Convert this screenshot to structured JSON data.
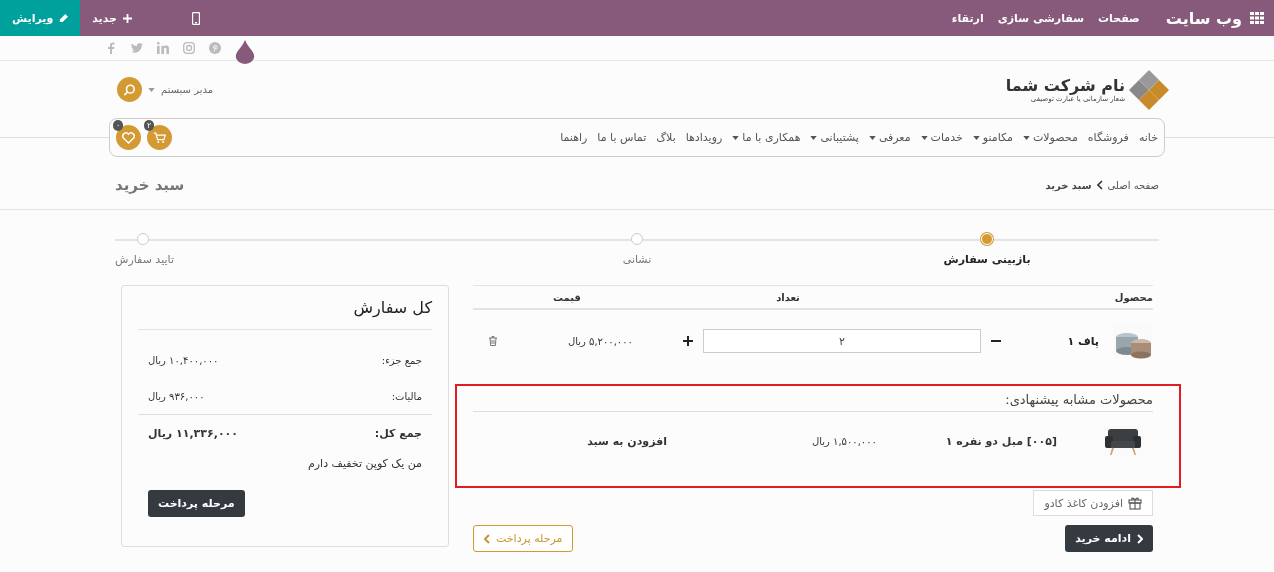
{
  "topbar": {
    "title": "وب سایت",
    "menu": [
      "صفحات",
      "سفارشی سازی",
      "ارتقاء"
    ],
    "new_label": "جدید",
    "edit_label": "ویرایش"
  },
  "header": {
    "company": "نام شرکت شما",
    "tagline": "شعار سازمانی یا عبارت توصیفی",
    "user": "مدیر سیستم"
  },
  "nav": {
    "items": [
      {
        "label": "خانه",
        "dropdown": false
      },
      {
        "label": "فروشگاه",
        "dropdown": false
      },
      {
        "label": "محصولات",
        "dropdown": true
      },
      {
        "label": "مکامنو",
        "dropdown": true
      },
      {
        "label": "خدمات",
        "dropdown": true
      },
      {
        "label": "معرفی",
        "dropdown": true
      },
      {
        "label": "پشتیبانی",
        "dropdown": true
      },
      {
        "label": "همکاری با ما",
        "dropdown": true
      },
      {
        "label": "رویدادها",
        "dropdown": false
      },
      {
        "label": "بلاگ",
        "dropdown": false
      },
      {
        "label": "تماس با ما",
        "dropdown": false
      },
      {
        "label": "راهنما",
        "dropdown": false
      }
    ],
    "cart_count": "۲",
    "wishlist_count": "۰"
  },
  "breadcrumb": {
    "items": [
      "صفحه اصلی",
      "سبد خرید"
    ],
    "title": "سبد خرید"
  },
  "steps": [
    {
      "label": "بازبینی سفارش",
      "selected": true
    },
    {
      "label": "نشانی",
      "selected": false
    },
    {
      "label": "تایید سفارش",
      "selected": false
    }
  ],
  "cart": {
    "columns": [
      "محصول",
      "تعداد",
      "قیمت"
    ],
    "rows": [
      {
        "name": "پاف ۱",
        "quantity": "۲",
        "price": "۵,۲۰۰,۰۰۰ ریال"
      }
    ]
  },
  "suggested": {
    "title": "محصولات مشابه پیشنهادی:",
    "highlighted": true,
    "items": [
      {
        "name": "[۰۰۵] مبل دو نفره ۱",
        "price": "۱,۵۰۰,۰۰۰ ریال",
        "action": "افزودن به سبد"
      }
    ]
  },
  "gift_wrap": "افزودن کاغذ کادو",
  "actions": {
    "continue": "ادامه خرید",
    "checkout": "مرحله پرداخت"
  },
  "summary": {
    "title": "کل سفارش",
    "lines": [
      {
        "label": "جمع جزء:",
        "value": "۱۰,۴۰۰,۰۰۰ ریال",
        "kind": "normal"
      },
      {
        "label": "مالیات:",
        "value": "۹۳۶,۰۰۰ ریال",
        "kind": "normal"
      },
      {
        "label": "جمع کل:",
        "value": "۱۱,۳۳۶,۰۰۰ ریال",
        "kind": "total"
      }
    ],
    "coupon": "من یک کوپن تخفیف دارم",
    "checkout": "مرحله پرداخت"
  }
}
